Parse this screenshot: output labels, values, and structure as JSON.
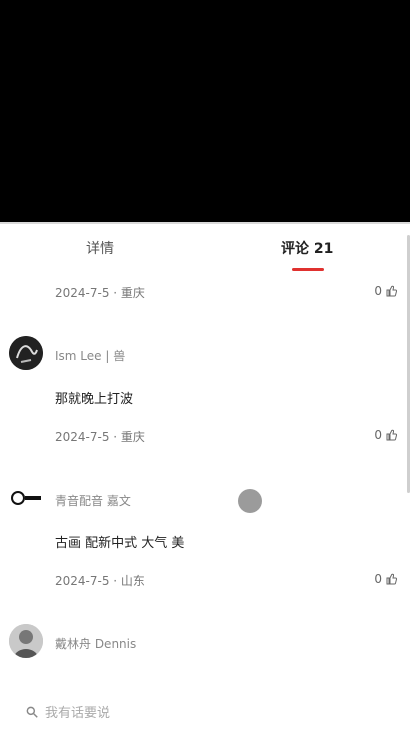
{
  "tabs": [
    {
      "label": "详情"
    },
    {
      "label": "评论 21"
    }
  ],
  "comments": [
    {
      "author": "",
      "text": "",
      "meta": "2024-7-5 · 重庆",
      "likes": "0"
    },
    {
      "author": "Ism Lee | 兽",
      "text": "那就晚上打波",
      "meta": "2024-7-5 · 重庆",
      "likes": "0"
    },
    {
      "author": "青音配音 嘉文",
      "text": "古画 配新中式 大气 美",
      "meta": "2024-7-5 · 山东",
      "likes": "0"
    },
    {
      "author": "戴林舟 Dennis",
      "text": "",
      "meta": "",
      "likes": ""
    }
  ],
  "bottom": {
    "placeholder": "我有话要说"
  }
}
